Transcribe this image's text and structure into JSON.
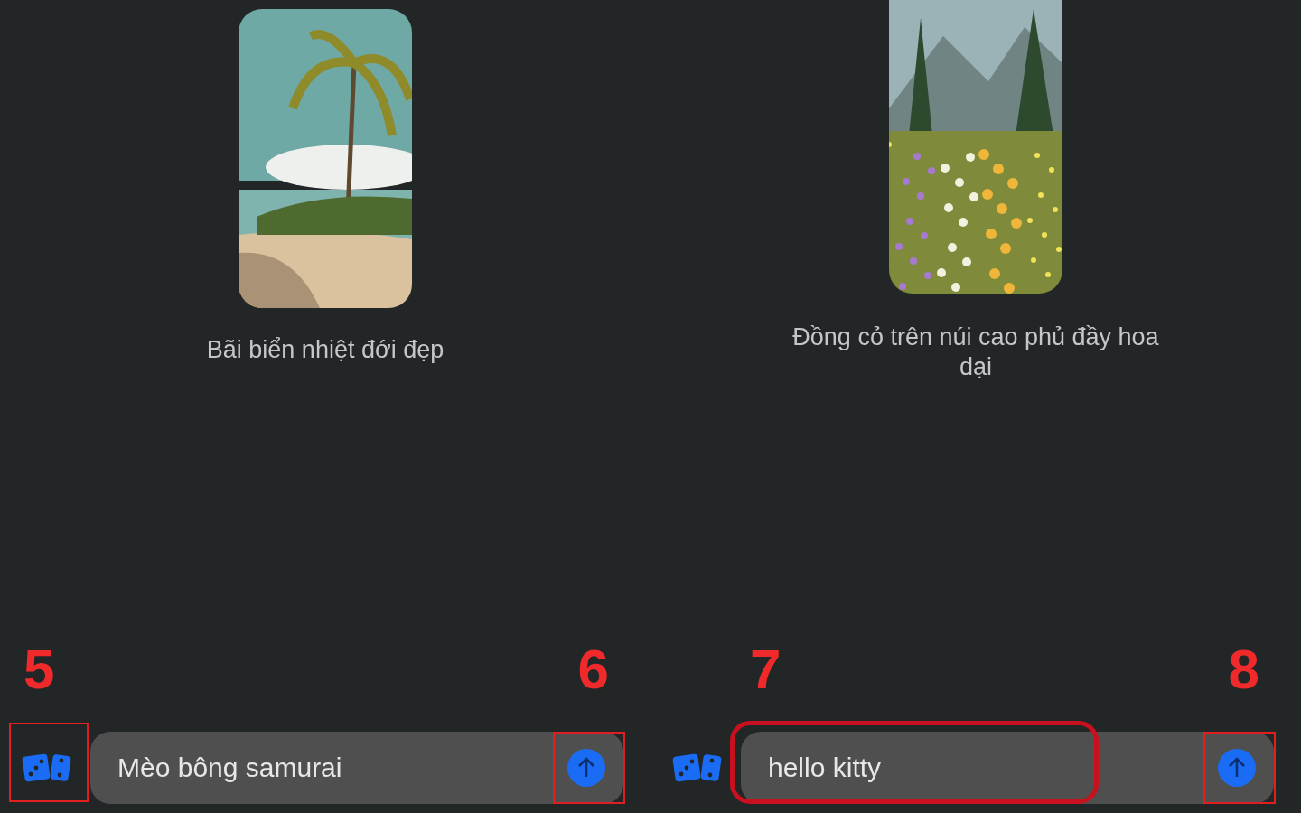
{
  "panels": [
    {
      "image": {
        "kind": "beach"
      },
      "caption": "Bãi biển nhiệt đới đẹp",
      "dice": {
        "highlighted": true,
        "callout": "5"
      },
      "prompt": {
        "value": "Mèo bông samurai",
        "highlighted": false
      },
      "send": {
        "highlighted": true,
        "callout": "6"
      }
    },
    {
      "image": {
        "kind": "meadow"
      },
      "caption": "Đồng cỏ trên núi cao phủ đầy hoa dại",
      "dice": {
        "highlighted": false
      },
      "prompt": {
        "value": "hello kitty",
        "highlighted": true,
        "callout": "7"
      },
      "send": {
        "highlighted": true,
        "callout": "8"
      }
    }
  ]
}
